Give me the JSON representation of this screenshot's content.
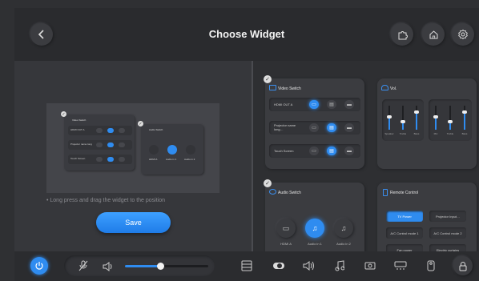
{
  "header": {
    "title": "Choose Widget"
  },
  "left": {
    "hint": "• Long press and drag the widget to the position",
    "save_label": "Save",
    "preview": {
      "video_title": "Video Switch",
      "video_rows": [
        "HDMI OUT A",
        "Projector name long",
        "Touch Screen"
      ],
      "audio_title": "Audio Switch",
      "audio_labels": [
        "HDMI A",
        "Audio in 1",
        "Audio in 2"
      ]
    }
  },
  "video_switch": {
    "title": "Video Switch",
    "rows": [
      {
        "label": "HDMI OUT A",
        "active": 0
      },
      {
        "label": "Projector name long…",
        "active": 1
      },
      {
        "label": "Touch Screen",
        "active": 1
      }
    ]
  },
  "vol": {
    "title": "Vol.",
    "group1": [
      {
        "label": "Speaker",
        "level": 0.55
      },
      {
        "label": "Treble",
        "level": 0.35
      },
      {
        "label": "Bass",
        "level": 0.75
      }
    ],
    "group2": [
      {
        "label": "Mic",
        "level": 0.55
      },
      {
        "label": "Treble",
        "level": 0.35
      },
      {
        "label": "Bass",
        "level": 0.75
      }
    ]
  },
  "audio_switch": {
    "title": "Audio Switch",
    "items": [
      "HDMI A",
      "Audio in 1",
      "Audio in 2"
    ],
    "active_index": 1
  },
  "remote_control": {
    "title": "Remote Control",
    "buttons": [
      {
        "label": "TV Power",
        "active": true
      },
      {
        "label": "Projector Input…",
        "active": false
      },
      {
        "label": "A/C Control mode 1",
        "active": false
      },
      {
        "label": "A/C Control mode 2",
        "active": false
      },
      {
        "label": "Fan power",
        "active": false
      },
      {
        "label": "Electric curtains",
        "active": false
      }
    ]
  },
  "bottom_bar": {
    "volume_level": 0.42,
    "accent": "#2f8cf0"
  }
}
